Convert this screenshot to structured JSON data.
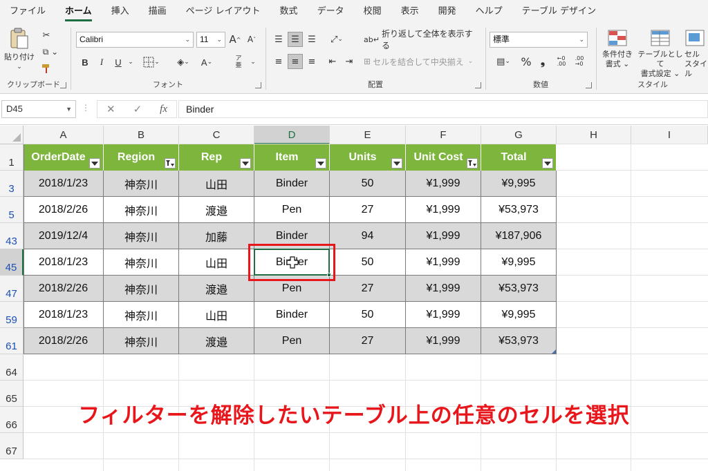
{
  "menu": {
    "tabs": [
      "ファイル",
      "ホーム",
      "挿入",
      "描画",
      "ページ レイアウト",
      "数式",
      "データ",
      "校閲",
      "表示",
      "開発",
      "ヘルプ",
      "テーブル デザイン"
    ],
    "active_index": 1
  },
  "ribbon": {
    "clipboard": {
      "paste_label": "貼り付け",
      "group_label": "クリップボード"
    },
    "font": {
      "name": "Calibri",
      "size": "11",
      "bold": "B",
      "italic": "I",
      "underline": "U",
      "group_label": "フォント",
      "grow": "A",
      "shrink": "A"
    },
    "alignment": {
      "wrap_text": "折り返して全体を表示する",
      "merge_center": "セルを結合して中央揃え",
      "group_label": "配置"
    },
    "number": {
      "format": "標準",
      "percent": "%",
      "comma": "❟",
      "group_label": "数値"
    },
    "styles": {
      "conditional": "条件付き",
      "conditional2": "書式",
      "table_format": "テーブルとして",
      "table_format2": "書式設定",
      "cell_styles": "セル",
      "cell_styles2": "スタイル",
      "group_label": "スタイル"
    }
  },
  "formula_bar": {
    "name_box": "D45",
    "fx": "fx",
    "cancel": "✕",
    "enter": "✓",
    "formula": "Binder"
  },
  "sheet": {
    "columns": [
      "A",
      "B",
      "C",
      "D",
      "E",
      "F",
      "G",
      "H",
      "I"
    ],
    "selected_column": "D",
    "header_row_number": "1",
    "table_headers": [
      "OrderDate",
      "Region",
      "Rep",
      "Item",
      "Units",
      "Unit Cost",
      "Total"
    ],
    "filtered_headers": [
      "Region",
      "Unit Cost"
    ],
    "rows": [
      {
        "num": "3",
        "cells": [
          "2018/1/23",
          "神奈川",
          "山田",
          "Binder",
          "50",
          "¥1,999",
          "¥9,995"
        ]
      },
      {
        "num": "5",
        "cells": [
          "2018/2/26",
          "神奈川",
          "渡邉",
          "Pen",
          "27",
          "¥1,999",
          "¥53,973"
        ]
      },
      {
        "num": "43",
        "cells": [
          "2019/12/4",
          "神奈川",
          "加藤",
          "Binder",
          "94",
          "¥1,999",
          "¥187,906"
        ]
      },
      {
        "num": "45",
        "cells": [
          "2018/1/23",
          "神奈川",
          "山田",
          "Binder",
          "50",
          "¥1,999",
          "¥9,995"
        ]
      },
      {
        "num": "47",
        "cells": [
          "2018/2/26",
          "神奈川",
          "渡邉",
          "Pen",
          "27",
          "¥1,999",
          "¥53,973"
        ]
      },
      {
        "num": "59",
        "cells": [
          "2018/1/23",
          "神奈川",
          "山田",
          "Binder",
          "50",
          "¥1,999",
          "¥9,995"
        ]
      },
      {
        "num": "61",
        "cells": [
          "2018/2/26",
          "神奈川",
          "渡邉",
          "Pen",
          "27",
          "¥1,999",
          "¥53,973"
        ]
      }
    ],
    "empty_rows": [
      "64",
      "65",
      "66",
      "67"
    ],
    "selected_cell": "D45"
  },
  "callout": "フィルターを解除したいテーブル上の任意のセルを選択",
  "colors": {
    "header_green": "#7db53d",
    "excel_green": "#1f6e43",
    "highlight_red": "#e8161b",
    "row_gray": "#d9d9d9",
    "filtered_row_blue": "#1b4fb5"
  }
}
